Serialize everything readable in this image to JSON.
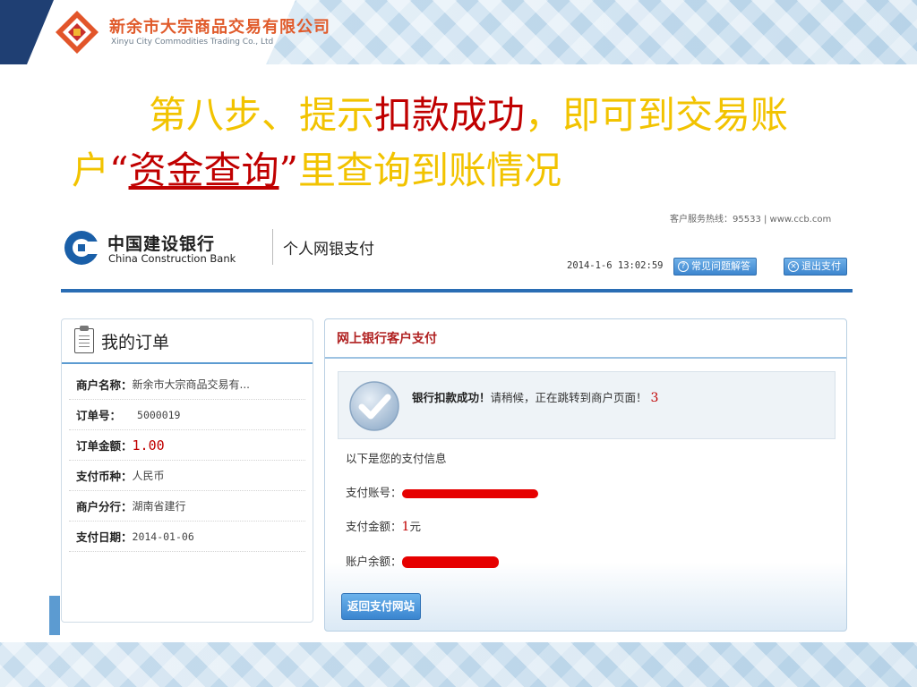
{
  "slide": {
    "company_cn": "新余市大宗商品交易有限公司",
    "company_en": "Xinyu City Commodities Trading Co., Ltd",
    "headline": {
      "part1": "第八步、提示",
      "part2": "扣款成功",
      "part3": "，即可到交易账户",
      "part4": "“",
      "part5": "资金查询",
      "part6": "”",
      "part7": "里查询到账情况"
    }
  },
  "bank": {
    "name_cn": "中国建设银行",
    "name_en": "China Construction Bank",
    "subtitle": "个人网银支付",
    "header_strip": "客户服务热线：95533 | www.ccb.com",
    "datetime": "2014-1-6 13:02:59",
    "faq_label": "常见问题解答",
    "exit_label": "退出支付",
    "colors": {
      "accent": "#2a6db4",
      "emphasis": "#c00000"
    }
  },
  "order": {
    "title": "我的订单",
    "rows": [
      {
        "key": "商户名称：",
        "value": "新余市大宗商品交易有..."
      },
      {
        "key": "订单号：",
        "value": "5000019"
      },
      {
        "key": "订单金额：",
        "value": "1.00"
      },
      {
        "key": "支付币种：",
        "value": "人民币"
      },
      {
        "key": "商户分行：",
        "value": "湖南省建行"
      },
      {
        "key": "支付日期：",
        "value": "2014-01-06"
      }
    ]
  },
  "payment": {
    "title": "网上银行客户支付",
    "success_bold": "银行扣款成功！",
    "success_rest": "请稍候，正在跳转到商户页面！",
    "countdown": "3",
    "info_heading": "以下是您的支付信息",
    "account_label": "支付账号：",
    "amount_label": "支付金额：",
    "amount_value": "1",
    "amount_unit": "元",
    "balance_label": "账户余额：",
    "back_button": "返回支付网站"
  }
}
